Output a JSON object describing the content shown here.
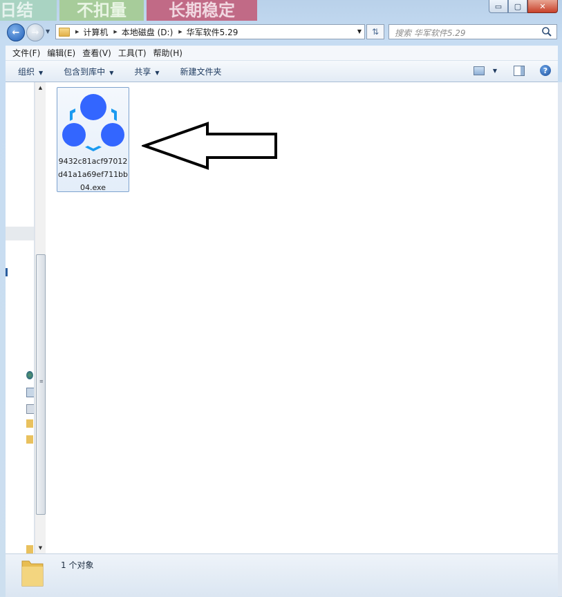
{
  "window": {
    "caption_buttons": {
      "minimize": "▭",
      "maximize": "▢",
      "close": "✕"
    }
  },
  "background_banner": {
    "segments": [
      "日结",
      "不扣量",
      "长期稳定"
    ]
  },
  "address_bar": {
    "breadcrumbs": [
      "计算机",
      "本地磁盘 (D:)",
      "华军软件5.29"
    ]
  },
  "search": {
    "placeholder": "搜索 华军软件5.29"
  },
  "menu": {
    "items": [
      "文件(F)",
      "编辑(E)",
      "查看(V)",
      "工具(T)",
      "帮助(H)"
    ]
  },
  "command_bar": {
    "items": [
      {
        "label": "组织",
        "has_dropdown": true
      },
      {
        "label": "包含到库中",
        "has_dropdown": true
      },
      {
        "label": "共享",
        "has_dropdown": true
      },
      {
        "label": "新建文件夹",
        "has_dropdown": false
      }
    ]
  },
  "files": [
    {
      "name": "9432c81acf97012d41a1a69ef711bb04.exe",
      "icon": "app-logo-icon",
      "selected": true
    }
  ],
  "status": {
    "item_count": "1 个对象"
  },
  "colors": {
    "accent": "#3366ff",
    "selection_border": "#7da2ce",
    "arrow": "#000000"
  }
}
